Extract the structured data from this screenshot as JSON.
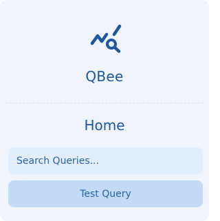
{
  "brand": {
    "name": "QBee",
    "icon": "chart-search-icon",
    "color": "#1e56a0"
  },
  "nav": {
    "home_label": "Home"
  },
  "search": {
    "placeholder": "Search Queries...",
    "value": ""
  },
  "actions": {
    "test_query_label": "Test Query"
  },
  "colors": {
    "panel_background": "#f1f5fb",
    "input_background": "#e3eefc",
    "button_background": "#c3dbf6",
    "accent": "#1e56a0"
  }
}
